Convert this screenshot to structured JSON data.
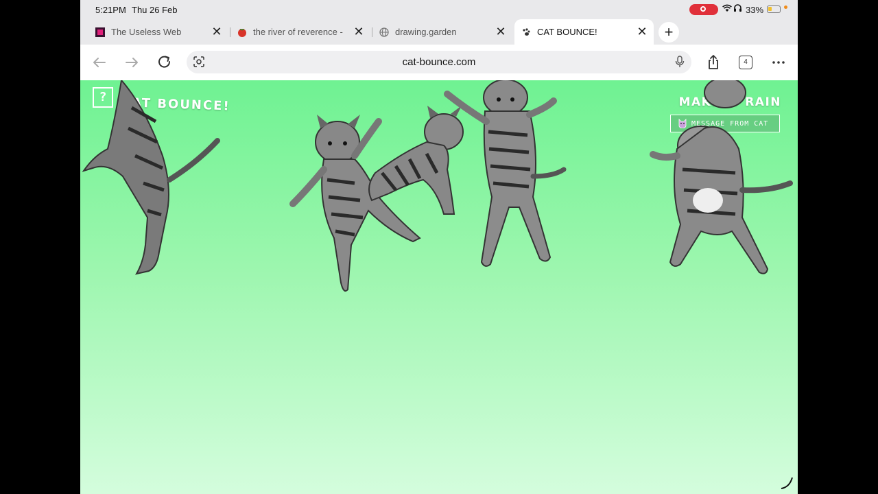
{
  "status": {
    "time": "5:21PM",
    "date": "Thu 26 Feb",
    "battery_pct": "33%",
    "battery_level": 0.33,
    "colors": {
      "record": "#e0303a",
      "battery": "#f2c12e"
    }
  },
  "tabs": [
    {
      "title": "The Useless Web",
      "icon": "useless-web-favicon",
      "active": false
    },
    {
      "title": "the river of reverence - ",
      "icon": "tomato-favicon",
      "active": false
    },
    {
      "title": "drawing.garden",
      "icon": "globe-favicon",
      "active": false
    },
    {
      "title": "CAT BOUNCE!",
      "icon": "paw-favicon",
      "active": true
    }
  ],
  "toolbar": {
    "url": "cat-bounce.com",
    "tab_count": "4"
  },
  "page": {
    "logo_glyph": "?",
    "logo_text": "CAT BOUNCE!",
    "make_it_rain": "MAKE IT RAIN",
    "message_from_cat": "MESSAGE FROM CAT",
    "background": {
      "top": "#6ff292",
      "bottom": "#d4fddd"
    }
  }
}
